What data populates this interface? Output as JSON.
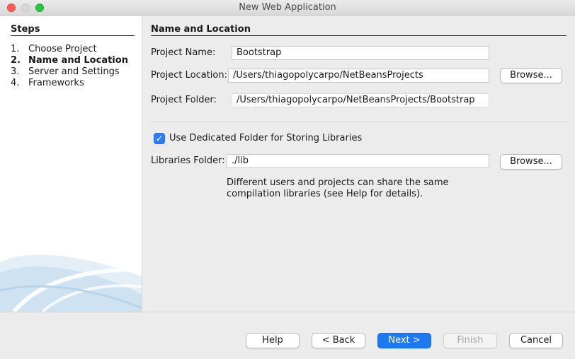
{
  "window": {
    "title": "New Web Application"
  },
  "sidebar": {
    "heading": "Steps",
    "steps": [
      {
        "num": "1.",
        "label": "Choose Project"
      },
      {
        "num": "2.",
        "label": "Name and Location"
      },
      {
        "num": "3.",
        "label": "Server and Settings"
      },
      {
        "num": "4.",
        "label": "Frameworks"
      }
    ],
    "current_step": 2
  },
  "panel": {
    "heading": "Name and Location",
    "project_name": {
      "label": "Project Name:",
      "value": "Bootstrap"
    },
    "project_location": {
      "label": "Project Location:",
      "value": "/Users/thiagopolycarpo/NetBeansProjects",
      "browse": "Browse..."
    },
    "project_folder": {
      "label": "Project Folder:",
      "value": "/Users/thiagopolycarpo/NetBeansProjects/Bootstrap"
    },
    "dedicated_folder": {
      "label": "Use Dedicated Folder for Storing Libraries",
      "checked": true
    },
    "libraries_folder": {
      "label": "Libraries Folder:",
      "value": "./lib",
      "browse": "Browse..."
    },
    "help_line1": "Different users and projects can share the same",
    "help_line2": "compilation libraries (see Help for details)."
  },
  "footer": {
    "help": "Help",
    "back": "< Back",
    "next": "Next >",
    "finish": "Finish",
    "cancel": "Cancel"
  },
  "colors": {
    "accent": "#1e78f0",
    "checkbox": "#2f7cf6"
  }
}
